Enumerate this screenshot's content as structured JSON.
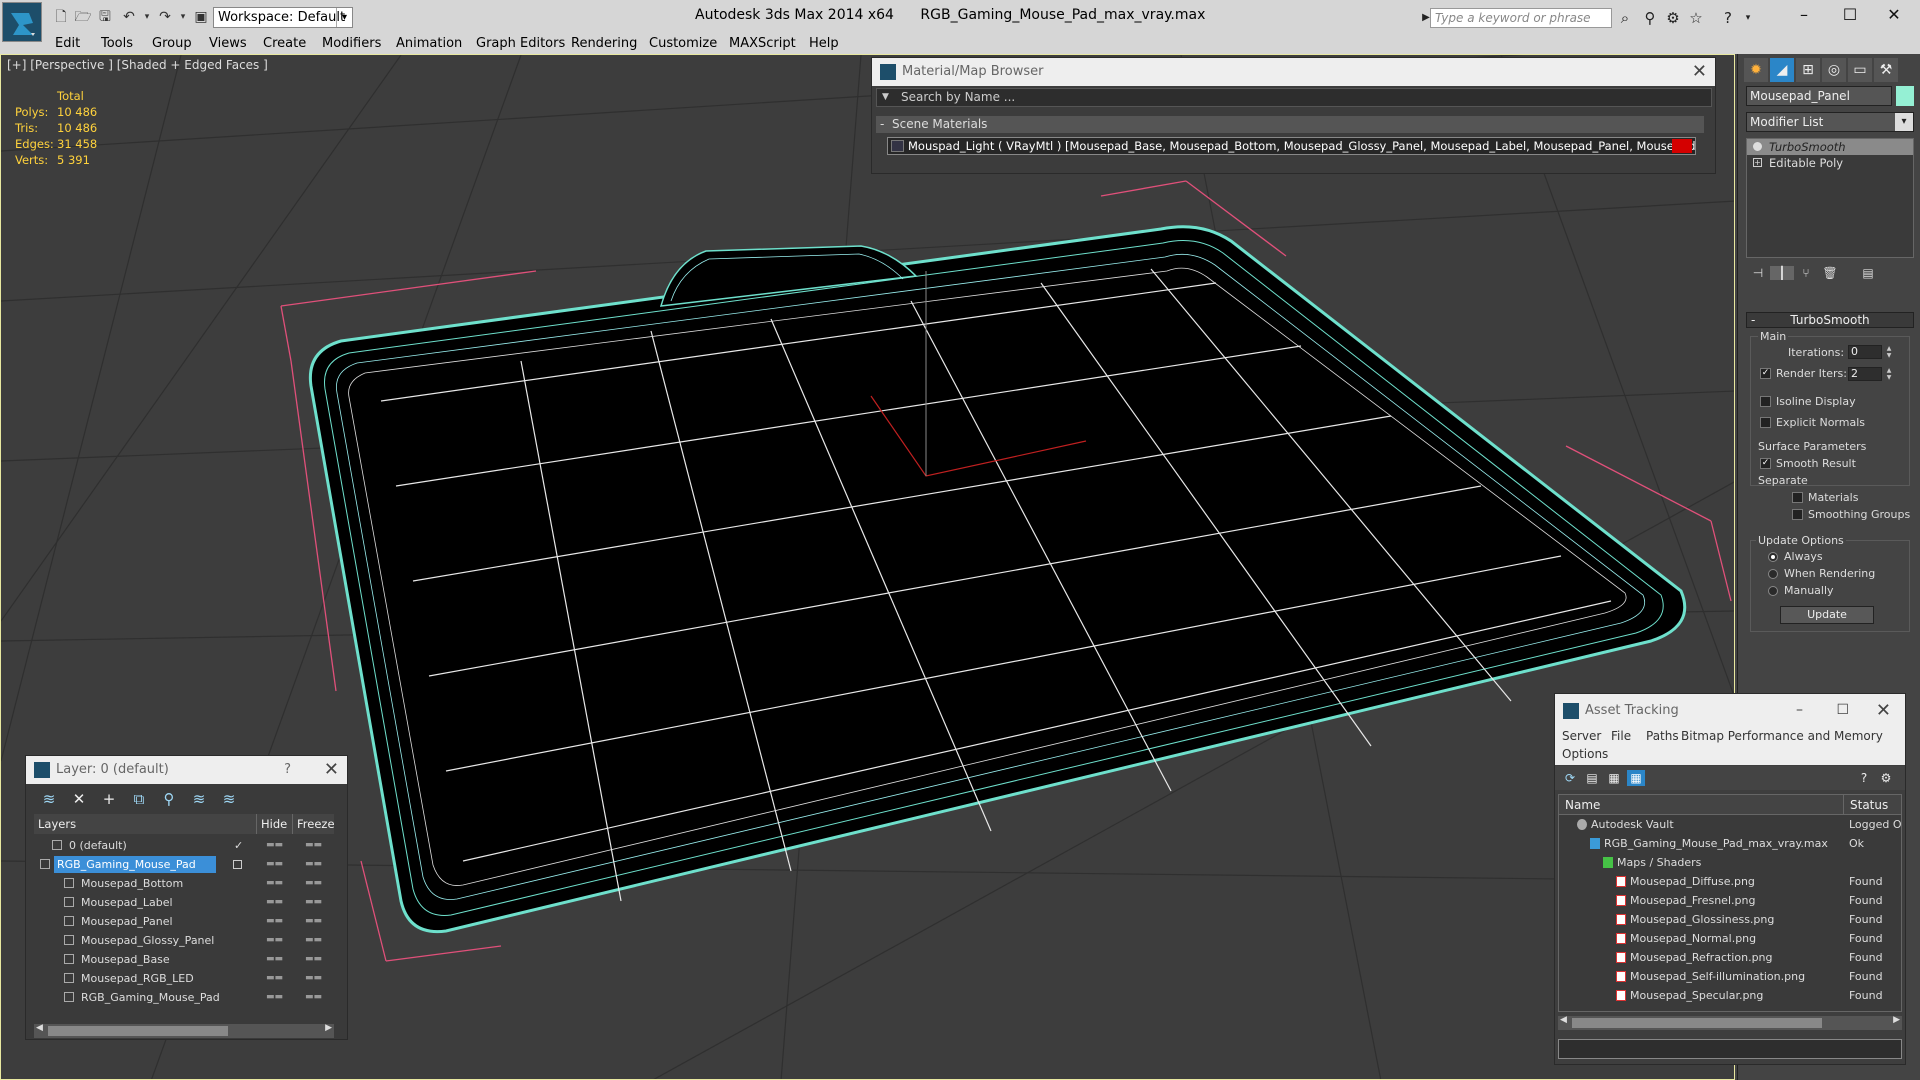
{
  "titlebar": {
    "workspace": "Workspace: Default",
    "app_name": "Autodesk 3ds Max  2014 x64",
    "file_name": "RGB_Gaming_Mouse_Pad_max_vray.max",
    "search_placeholder": "Type a keyword or phrase"
  },
  "menu": [
    "Edit",
    "Tools",
    "Group",
    "Views",
    "Create",
    "Modifiers",
    "Animation",
    "Graph Editors",
    "Rendering",
    "Customize",
    "MAXScript",
    "Help"
  ],
  "viewport": {
    "label": "[+] [Perspective ] [Shaded + Edged Faces ]",
    "stats": {
      "header": "Total",
      "rows": [
        {
          "label": "Polys:",
          "value": "10 486"
        },
        {
          "label": "Tris:",
          "value": "10 486"
        },
        {
          "label": "Edges:",
          "value": "31 458"
        },
        {
          "label": "Verts:",
          "value": "5 391"
        }
      ]
    }
  },
  "material_browser": {
    "title": "Material/Map Browser",
    "search_placeholder": "Search by Name ...",
    "section": "Scene Materials",
    "item": "Mouspad_Light ( VRayMtl ) [Mousepad_Base, Mousepad_Bottom, Mousepad_Glossy_Panel, Mousepad_Label, Mousepad_Panel, Mousepad_RGB_LED]",
    "swatch_color": "#d40000"
  },
  "command_panel": {
    "object_name": "Mousepad_Panel",
    "object_color": "#95f0d4",
    "modifier_list": "Modifier List",
    "stack": [
      "TurboSmooth",
      "Editable Poly"
    ],
    "rollout_title": "TurboSmooth",
    "main_group": "Main",
    "iterations_label": "Iterations:",
    "iterations_value": "0",
    "render_iters_label": "Render Iters:",
    "render_iters_value": "2",
    "render_iters_checked": true,
    "isoline_label": "Isoline Display",
    "explicit_normals_label": "Explicit Normals",
    "surface_params_group": "Surface Parameters",
    "smooth_result_label": "Smooth Result",
    "separate_label": "Separate",
    "materials_label": "Materials",
    "smoothing_groups_label": "Smoothing Groups",
    "update_options_group": "Update Options",
    "update_always": "Always",
    "update_when_rendering": "When Rendering",
    "update_manually": "Manually",
    "update_button": "Update"
  },
  "layer_explorer": {
    "title": "Layer: 0 (default)",
    "help": "?",
    "col_layers": "Layers",
    "col_hide": "Hide",
    "col_freeze": "Freeze",
    "rows": [
      {
        "name": "0 (default)",
        "indent": 1,
        "type": "layer",
        "current": true
      },
      {
        "name": "RGB_Gaming_Mouse_Pad",
        "indent": 0,
        "type": "layer",
        "selected": true
      },
      {
        "name": "Mousepad_Bottom",
        "indent": 2,
        "type": "object"
      },
      {
        "name": "Mousepad_Label",
        "indent": 2,
        "type": "object"
      },
      {
        "name": "Mousepad_Panel",
        "indent": 2,
        "type": "object"
      },
      {
        "name": "Mousepad_Glossy_Panel",
        "indent": 2,
        "type": "object"
      },
      {
        "name": "Mousepad_Base",
        "indent": 2,
        "type": "object"
      },
      {
        "name": "Mousepad_RGB_LED",
        "indent": 2,
        "type": "object"
      },
      {
        "name": "RGB_Gaming_Mouse_Pad",
        "indent": 2,
        "type": "object"
      }
    ]
  },
  "asset_tracking": {
    "title": "Asset Tracking",
    "menu": [
      "Server",
      "File",
      "Paths",
      "Bitmap Performance and Memory",
      "Options"
    ],
    "col_name": "Name",
    "col_status": "Status",
    "rows": [
      {
        "name": "Autodesk Vault",
        "status": "Logged O",
        "indent": 0,
        "icon": "vault"
      },
      {
        "name": "RGB_Gaming_Mouse_Pad_max_vray.max",
        "status": "Ok",
        "indent": 1,
        "icon": "max"
      },
      {
        "name": "Maps / Shaders",
        "status": "",
        "indent": 2,
        "icon": "folder"
      },
      {
        "name": "Mousepad_Diffuse.png",
        "status": "Found",
        "indent": 3,
        "icon": "png"
      },
      {
        "name": "Mousepad_Fresnel.png",
        "status": "Found",
        "indent": 3,
        "icon": "png"
      },
      {
        "name": "Mousepad_Glossiness.png",
        "status": "Found",
        "indent": 3,
        "icon": "png"
      },
      {
        "name": "Mousepad_Normal.png",
        "status": "Found",
        "indent": 3,
        "icon": "png"
      },
      {
        "name": "Mousepad_Refraction.png",
        "status": "Found",
        "indent": 3,
        "icon": "png"
      },
      {
        "name": "Mousepad_Self-illumination.png",
        "status": "Found",
        "indent": 3,
        "icon": "png"
      },
      {
        "name": "Mousepad_Specular.png",
        "status": "Found",
        "indent": 3,
        "icon": "png"
      }
    ]
  }
}
